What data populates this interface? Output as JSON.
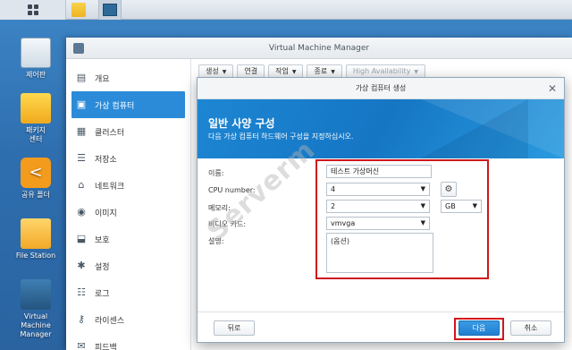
{
  "desktop": {
    "icons": [
      {
        "label": "제어판"
      },
      {
        "label": "패키지\n센터"
      },
      {
        "label": "공유 폴더"
      },
      {
        "label": "File Station"
      },
      {
        "label": "Virtual Machine\nManager"
      }
    ]
  },
  "window": {
    "title": "Virtual Machine Manager",
    "sidebar": [
      {
        "label": "개요",
        "icon": "overview-icon"
      },
      {
        "label": "가상 컴퓨터",
        "icon": "virtual-machine-icon"
      },
      {
        "label": "클러스터",
        "icon": "cluster-icon"
      },
      {
        "label": "저장소",
        "icon": "storage-icon"
      },
      {
        "label": "네트워크",
        "icon": "network-icon"
      },
      {
        "label": "이미지",
        "icon": "image-icon"
      },
      {
        "label": "보호",
        "icon": "protection-icon"
      },
      {
        "label": "설정",
        "icon": "settings-icon"
      },
      {
        "label": "로그",
        "icon": "log-icon"
      },
      {
        "label": "라이센스",
        "icon": "license-icon"
      },
      {
        "label": "피드백",
        "icon": "feedback-icon"
      }
    ],
    "toolbar": {
      "create": "생성",
      "connect": "연결",
      "action": "작업",
      "shutdown": "종료",
      "ha": "High Availability"
    }
  },
  "dialog": {
    "title": "가상 컴퓨터 생성",
    "banner_title": "일반 사양 구성",
    "banner_subtitle": "다음 가상 컴퓨터 하드웨어 구성을 지정하십시오.",
    "fields": {
      "name_label": "이름:",
      "name_value": "테스트 가상머신",
      "cpu_label": "CPU number:",
      "cpu_value": "4",
      "memory_label": "메모리:",
      "memory_value": "2",
      "memory_unit": "GB",
      "video_label": "비디오 카드:",
      "video_value": "vmvga",
      "desc_label": "설명:",
      "desc_placeholder": "(옵션)"
    },
    "buttons": {
      "back": "뒤로",
      "next": "다음",
      "cancel": "취소"
    }
  },
  "watermark": "Serverm"
}
